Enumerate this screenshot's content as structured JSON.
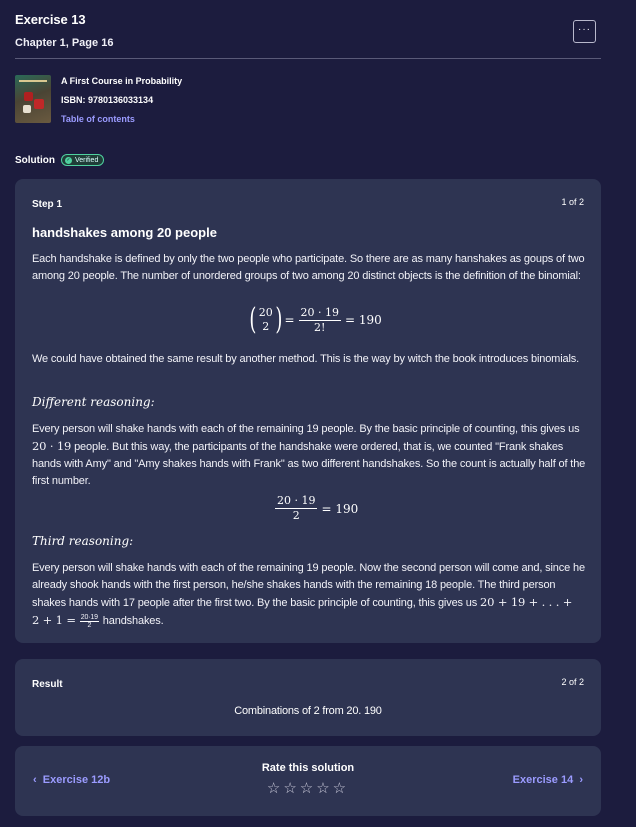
{
  "header": {
    "title": "Exercise 13",
    "subtitle": "Chapter 1, Page 16",
    "more_label": "···"
  },
  "book": {
    "title": "A First Course in Probability",
    "isbn": "ISBN: 9780136033134",
    "toc_link": "Table of contents"
  },
  "solution": {
    "label": "Solution",
    "badge": "Verified"
  },
  "step1": {
    "label": "Step 1",
    "count": "1 of 2",
    "heading": "handshakes among 20 people",
    "para1": "Each handshake is defined by only the two people who participate. So there are as many hanshakes as goups of two among 20 people. The number of unordered groups of two among 20 distinct objects is the definition of the binomial:",
    "formula1": {
      "binom_top": "20",
      "binom_bottom": "2",
      "eq": "=",
      "num": "20 · 19",
      "den": "2!",
      "result": "= 190"
    },
    "para2": "We could have obtained the same result by another method. This is the way by witch the book introduces binomials.",
    "subheading1": "Different reasoning:",
    "para3a": "Every person will shake hands with each of the remaining 19 people. By the basic principle of counting, this gives us ",
    "para3_math": "20 · 19",
    "para3b": " people. But this way, the participants of the handshake were ordered, that is, we counted \"Frank shakes hands with Amy\" and \"Amy shakes hands with Frank\" as two different handshakes. So the count is actually half of the first number.",
    "formula2": {
      "num": "20 · 19",
      "den": "2",
      "result": "= 190"
    },
    "subheading2": "Third reasoning:",
    "para4a": "Every person will shake hands with each of the remaining 19 people. Now the second person will come and, since he already shook hands with the first person, he/she shakes hands with the remaining 18 people. The third person shakes hands with 17 people after the first two. By the basic principle of counting, this gives us ",
    "para4_math1": "20 + 19 + . . . +",
    "para4_math2": "2 + 1 =",
    "para4_frac_num": "20·19",
    "para4_frac_den": "2",
    "para4b": " handshakes."
  },
  "result": {
    "label": "Result",
    "count": "2 of 2",
    "text": "Combinations of 2 from 20. 190"
  },
  "footer": {
    "prev": "Exercise 12b",
    "next": "Exercise 14",
    "rate_title": "Rate this solution",
    "stars": "☆☆☆☆☆",
    "rating": 0
  }
}
